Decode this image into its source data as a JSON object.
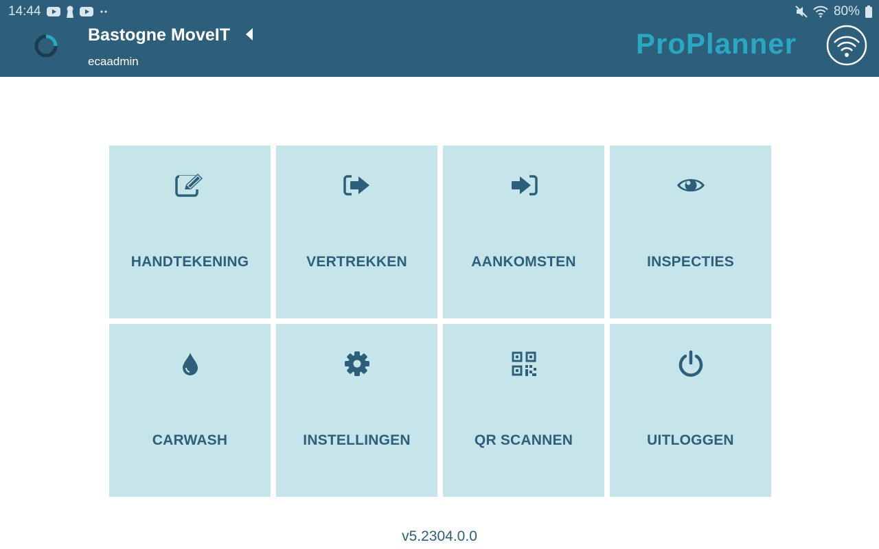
{
  "status_bar": {
    "time": "14:44",
    "battery": "80%",
    "left_icons": [
      "youtube-icon",
      "keyhole-icon",
      "youtube-icon",
      "more-dots-icon"
    ],
    "right_icons": [
      "mute-icon",
      "wifi-icon",
      "battery-icon"
    ]
  },
  "header": {
    "app_title": "Bastogne MoveIT",
    "username": "ecaadmin",
    "logo_text": "ProPlanner",
    "background_color": "#2e5f7a",
    "logo_color": "#29a8c4"
  },
  "tiles": [
    {
      "label": "HANDTEKENING",
      "icon": "edit-icon"
    },
    {
      "label": "VERTREKKEN",
      "icon": "sign-out-icon"
    },
    {
      "label": "AANKOMSTEN",
      "icon": "sign-in-icon"
    },
    {
      "label": "INSPECTIES",
      "icon": "eye-icon"
    },
    {
      "label": "CARWASH",
      "icon": "water-drop-icon"
    },
    {
      "label": "INSTELLINGEN",
      "icon": "gear-icon"
    },
    {
      "label": "QR SCANNEN",
      "icon": "qr-code-icon"
    },
    {
      "label": "UITLOGGEN",
      "icon": "power-icon"
    }
  ],
  "tile_color": "#c5e5ea",
  "version": "v5.2304.0.0"
}
